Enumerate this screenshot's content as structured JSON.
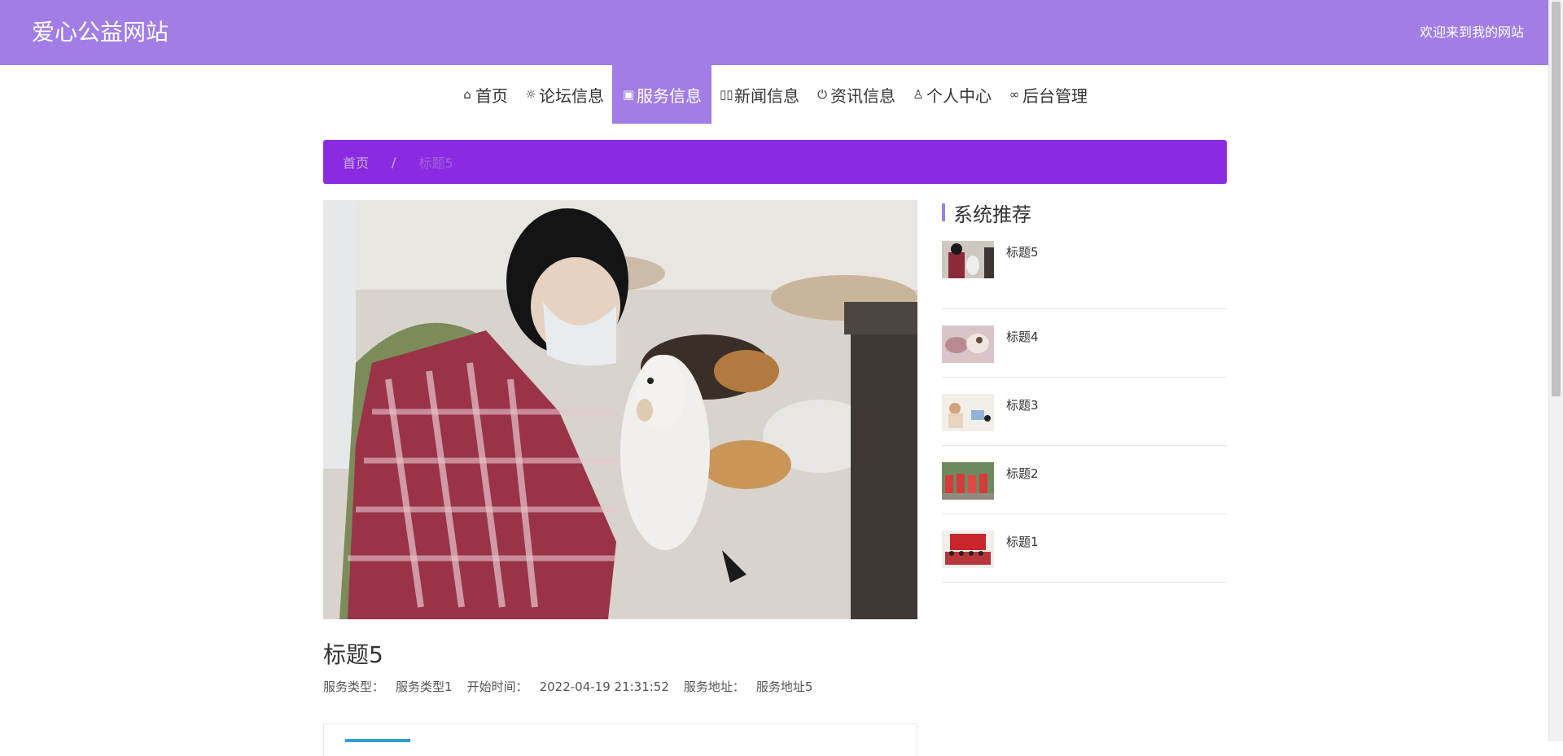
{
  "header": {
    "site_title": "爱心公益网站",
    "welcome": "欢迎来到我的网站",
    "accent_color": "#a17de5"
  },
  "nav": {
    "items": [
      {
        "label": "首页",
        "icon": "home-icon"
      },
      {
        "label": "论坛信息",
        "icon": "settings-icon"
      },
      {
        "label": "服务信息",
        "icon": "gift-icon",
        "active": true
      },
      {
        "label": "新闻信息",
        "icon": "book-icon"
      },
      {
        "label": "资讯信息",
        "icon": "power-icon"
      },
      {
        "label": "个人中心",
        "icon": "user-icon"
      },
      {
        "label": "后台管理",
        "icon": "link-icon"
      }
    ]
  },
  "breadcrumb": {
    "home": "首页",
    "separator": "/",
    "current": "标题5",
    "bg_color": "#8a2be2"
  },
  "detail": {
    "title": "标题5",
    "meta": [
      {
        "label": "服务类型：",
        "value": "服务类型1"
      },
      {
        "label": "开始时间：",
        "value": "2022-04-19 21:31:52"
      },
      {
        "label": "服务地址：",
        "value": "服务地址5"
      }
    ]
  },
  "sidebar": {
    "title": "系统推荐",
    "items": [
      {
        "title": "标题5"
      },
      {
        "title": "标题4"
      },
      {
        "title": "标题3"
      },
      {
        "title": "标题2"
      },
      {
        "title": "标题1"
      }
    ]
  }
}
